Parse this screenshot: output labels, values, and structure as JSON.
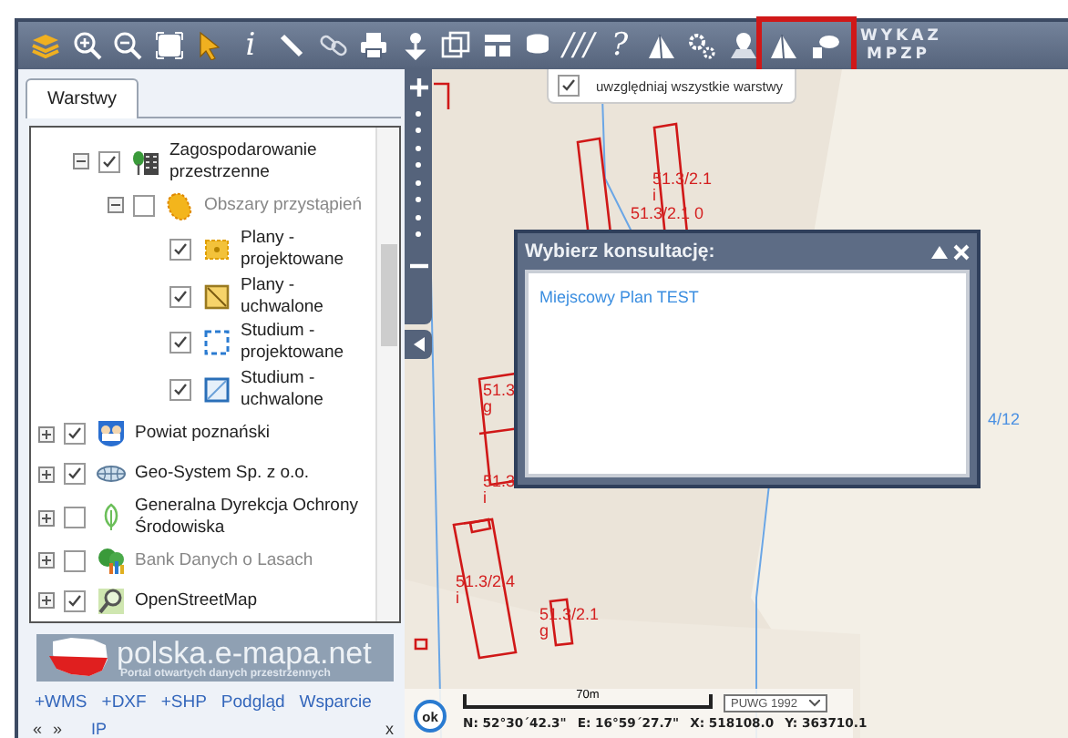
{
  "toolbar": {
    "tools": [
      {
        "kind": "layers"
      },
      {
        "kind": "zoom-in"
      },
      {
        "kind": "zoom-out"
      },
      {
        "kind": "fullscreen"
      },
      {
        "kind": "pointer"
      },
      {
        "kind": "glyph",
        "label": "i"
      },
      {
        "kind": "ruler"
      },
      {
        "kind": "link"
      },
      {
        "kind": "print"
      },
      {
        "kind": "pin"
      },
      {
        "kind": "copy"
      },
      {
        "kind": "layout"
      },
      {
        "kind": "bubble"
      },
      {
        "kind": "glyph",
        "label": "///"
      },
      {
        "kind": "glyph",
        "label": "?"
      },
      {
        "kind": "peak"
      },
      {
        "kind": "gears"
      },
      {
        "kind": "place"
      }
    ],
    "framed_tools": [
      {
        "kind": "peak"
      },
      {
        "kind": "chat"
      }
    ],
    "text_tool": "WYKAZ MPZP"
  },
  "tabs": [
    {
      "label": "Warstwy",
      "selected": true
    }
  ],
  "layers": {
    "partial_branch": [
      {
        "label": "Zagospodarowanie przestrzenne",
        "kind": "buildings",
        "checked": true,
        "expanded": true,
        "disabled": false,
        "children": [
          {
            "label": "Obszary przystąpień",
            "kind": "blob",
            "checked": false,
            "expanded": true,
            "disabled": true,
            "children": [
              {
                "label": "Plany - projektowane",
                "kind": "dotsquare",
                "checked": true,
                "disabled": false
              },
              {
                "label": "Plany - uchwalone",
                "kind": "hatchsquare",
                "checked": true,
                "disabled": false
              },
              {
                "label": "Studium - projektowane",
                "kind": "dashframe",
                "checked": true,
                "disabled": false
              },
              {
                "label": "Studium - uchwalone",
                "kind": "frame",
                "checked": true,
                "disabled": false
              }
            ]
          }
        ]
      }
    ],
    "items": [
      {
        "label": "Powiat poznański",
        "kind": "crest",
        "checked": true,
        "expanded": false,
        "disabled": false
      },
      {
        "label": "Geo-System Sp. z o.o.",
        "kind": "globe",
        "checked": true,
        "expanded": false,
        "disabled": false
      },
      {
        "label": "Generalna Dyrekcja Ochrony Środowiska",
        "kind": "leaf",
        "checked": false,
        "expanded": false,
        "disabled": false
      },
      {
        "label": "Bank Danych o Lasach",
        "kind": "forest",
        "checked": false,
        "expanded": false,
        "disabled": true
      },
      {
        "label": "OpenStreetMap",
        "kind": "magnifier",
        "checked": true,
        "expanded": false,
        "disabled": false
      }
    ]
  },
  "banner": {
    "title": "polska.e-mapa.net",
    "subtitle": "Portal otwartych danych przestrzennych"
  },
  "links": [
    "+WMS",
    "+DXF",
    "+SHP",
    "Podgląd",
    "Wsparcie"
  ],
  "footer": {
    "prev": "«",
    "next": "»",
    "ip": "IP",
    "close": "x"
  },
  "map": {
    "parcel_labels": [
      {
        "text": "51.3/2.1",
        "line2": "i",
        "color": "#d42020"
      },
      {
        "text": "51.3/2.1 0",
        "color": "#d42020"
      },
      {
        "text": "51.3",
        "line2": "g",
        "color": "#d42020"
      },
      {
        "text": "51.3",
        "line2": "i",
        "color": "#d42020"
      },
      {
        "text": "51.3/2.4",
        "line2": "i",
        "color": "#d42020"
      },
      {
        "text": "51.3/2.1",
        "line2": "g",
        "color": "#d42020"
      },
      {
        "text": "4/12",
        "color": "#4a90e2"
      }
    ],
    "all_layers_option": {
      "label": "uwzględniaj wszystkie warstwy",
      "checked": true
    },
    "dialog": {
      "title": "Wybierz konsultację:",
      "items": [
        "Miejscowy Plan TEST"
      ]
    },
    "status": {
      "ok": "ok",
      "scale": "70m",
      "projection": "PUWG 1992",
      "coords": [
        "N: 52°30´42.3\"",
        "E: 16°59´27.7\"",
        "X: 518108.0",
        "Y: 363710.1"
      ]
    }
  }
}
